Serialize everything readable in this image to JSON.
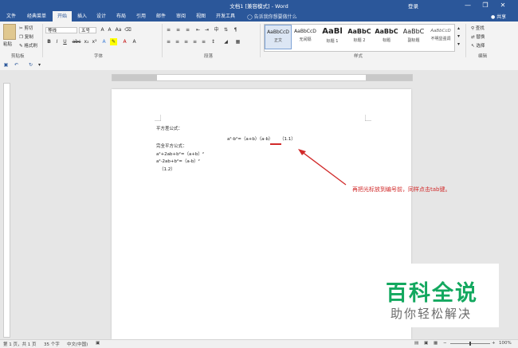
{
  "window": {
    "title": "文档1 [兼容模式] - Word",
    "login": "登录",
    "minimize_glyph": "—",
    "restore_glyph": "❐",
    "close_glyph": "✕"
  },
  "tabs": [
    "文件",
    "经典菜单",
    "开始",
    "插入",
    "设计",
    "布局",
    "引用",
    "邮件",
    "审阅",
    "视图",
    "开发工具"
  ],
  "active_tab": "开始",
  "tell_me": "告诉我你想要做什么",
  "share": "共享",
  "ribbon": {
    "clipboard": {
      "paste": "粘贴",
      "cut": "剪切",
      "copy": "复制",
      "format_painter": "格式刷",
      "label": "剪贴板"
    },
    "font": {
      "name": "等线",
      "size": "五号",
      "label": "字体"
    },
    "paragraph": {
      "label": "段落"
    },
    "styles": {
      "label": "样式",
      "items": [
        {
          "sample": "AaBbCcD",
          "name": "正文"
        },
        {
          "sample": "AaBbCcD",
          "name": "无间隔"
        },
        {
          "sample": "AaBl",
          "name": "标题 1"
        },
        {
          "sample": "AaBbC",
          "name": "标题 2"
        },
        {
          "sample": "AaBbC",
          "name": "标题"
        },
        {
          "sample": "AaBbC",
          "name": "副标题"
        },
        {
          "sample": "AaBbCcD",
          "name": "不明显强调"
        }
      ]
    },
    "editing": {
      "find": "查找",
      "replace": "替换",
      "select": "选择",
      "label": "编辑"
    }
  },
  "document": {
    "heading": "平方差公式：",
    "equation": "a²-b²=（a+b）（a-b）",
    "equation_number": "（1.1）",
    "section": "完全平方公式：",
    "line1": "a²+2ab+b²=（a+b）²",
    "line2": "a²-2ab+b²=（a-b）²",
    "number2": "（1.2）"
  },
  "annotation": "再把光标放到编号前，同样点击tab键。",
  "watermark": {
    "line1": "百科全说",
    "line2": "助你轻松解决"
  },
  "status": {
    "page": "第 1 页，共 1 页",
    "words": "35 个字",
    "language": "中文(中国)",
    "zoom": "100%"
  },
  "colors": {
    "word_blue": "#2b579a",
    "annotation_red": "#d12a2a",
    "watermark_green": "#13a85f"
  }
}
